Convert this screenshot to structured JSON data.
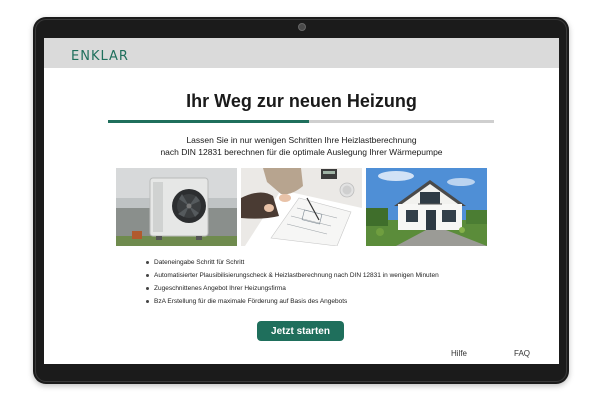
{
  "header": {
    "logo_text": "ENKLAR"
  },
  "main": {
    "title": "Ihr Weg zur neuen Heizung",
    "progress_fraction": 0.52,
    "intro_line1": "Lassen Sie in nur wenigen Schritten Ihre Heizlastberechnung",
    "intro_line2": "nach DIN 12831 berechnen für die optimale Auslegung Ihrer Wärmepumpe",
    "images": [
      "heat-pump-photo",
      "planning-documents-photo",
      "house-photo"
    ],
    "bullets": [
      "Dateneingabe Schritt für Schritt",
      "Automatisierter Plausibilisierungscheck & Heizlastberechnung nach DIN 12831 in wenigen Minuten",
      "Zugeschnittenes Angebot Ihrer Heizungsfirma",
      "BzA Erstellung für die maximale Förderung  auf Basis des Angebots"
    ],
    "start_button": "Jetzt starten"
  },
  "footer": {
    "help": "Hilfe",
    "faq": "FAQ"
  },
  "colors": {
    "brand": "#1f6f5c",
    "header_bg": "#dadada",
    "progress_track": "#cfcfcf"
  }
}
